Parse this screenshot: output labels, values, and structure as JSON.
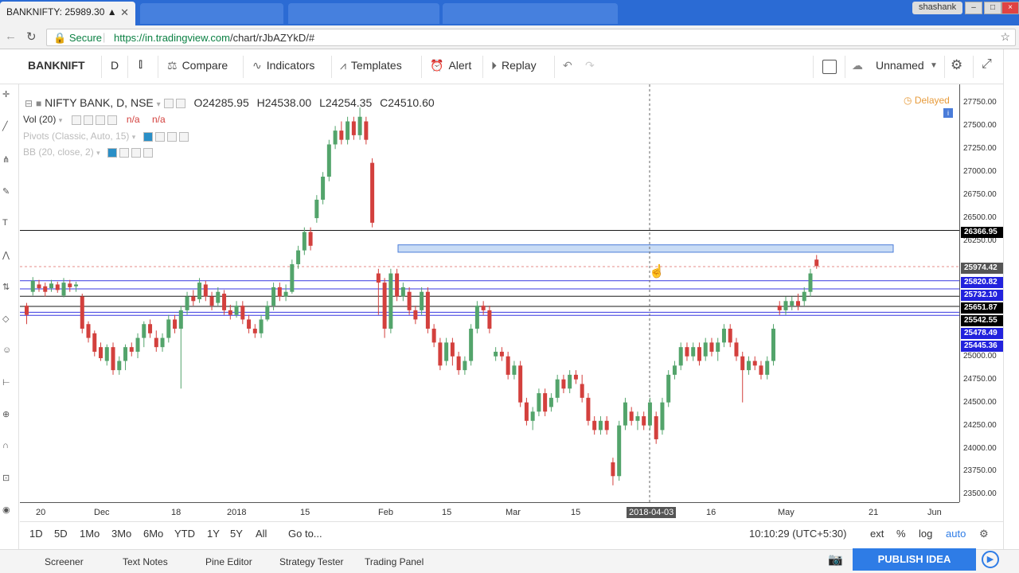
{
  "browser": {
    "tab_title": "BANKNIFTY: 25989.30 ▲",
    "tab_close": "✕",
    "profile": "shashank",
    "secure_label": "Secure",
    "url_host": "https://in.tradingview.com",
    "url_path": "/chart/rJbAZYkD/#"
  },
  "toolbar": {
    "symbol": "BANKNIFT",
    "interval": "D",
    "compare": "Compare",
    "indicators": "Indicators",
    "templates": "Templates",
    "alert": "Alert",
    "replay": "Replay",
    "layout_name": "Unnamed"
  },
  "legend": {
    "title": "NIFTY BANK, D, NSE",
    "open": "O24285.95",
    "high": "H24538.00",
    "low": "L24254.35",
    "close": "C24510.60",
    "vol": "Vol (20)",
    "vol_a": "n/a",
    "vol_b": "n/a",
    "pivots": "Pivots (Classic, Auto, 15)",
    "bb": "BB (20, close, 2)",
    "delayed": "Delayed"
  },
  "price_axis": {
    "ticks": [
      "27750.00",
      "27500.00",
      "27250.00",
      "27000.00",
      "26750.00",
      "26500.00",
      "26250.00",
      "25000.00",
      "24750.00",
      "24500.00",
      "24250.00",
      "24000.00",
      "23750.00",
      "23500.00"
    ],
    "tags": [
      {
        "label": "26366.95",
        "color": "#000000"
      },
      {
        "label": "25974.42",
        "color": "#555555"
      },
      {
        "label": "25820.82",
        "color": "#2222dd"
      },
      {
        "label": "25732.10",
        "color": "#2222dd"
      },
      {
        "label": "25651.87",
        "color": "#000000"
      },
      {
        "label": "25542.55",
        "color": "#000000"
      },
      {
        "label": "25478.49",
        "color": "#2222dd"
      },
      {
        "label": "25445.36",
        "color": "#2222dd"
      }
    ]
  },
  "time_axis": {
    "labels": [
      "20",
      "Dec",
      "18",
      "2018",
      "15",
      "Feb",
      "15",
      "Mar",
      "15",
      "2018-04-03",
      "16",
      "May",
      "21",
      "Jun"
    ]
  },
  "range_bar": {
    "ranges": [
      "1D",
      "5D",
      "1Mo",
      "3Mo",
      "6Mo",
      "YTD",
      "1Y",
      "5Y",
      "All"
    ],
    "goto": "Go to...",
    "clock": "10:10:29 (UTC+5:30)",
    "ext": "ext",
    "pct": "%",
    "log": "log",
    "auto": "auto"
  },
  "bottom_tabs": [
    "Screener",
    "Text Notes",
    "Pine Editor",
    "Strategy Tester",
    "Trading Panel"
  ],
  "publish": "PUBLISH IDEA",
  "colors": {
    "up": "#53a46b",
    "down": "#d3403d",
    "accent": "#2e7ce6"
  },
  "chart_data": {
    "type": "candlestick",
    "ylim": [
      23400,
      27900
    ],
    "candles": [
      [
        25550,
        25450,
        25580,
        25350
      ],
      [
        25700,
        25820,
        25860,
        25660
      ],
      [
        25780,
        25740,
        25830,
        25700
      ],
      [
        25760,
        25700,
        25800,
        25650
      ],
      [
        25740,
        25790,
        25830,
        25700
      ],
      [
        25780,
        25720,
        25810,
        25690
      ],
      [
        25660,
        25800,
        25850,
        25640
      ],
      [
        25790,
        25750,
        25830,
        25700
      ],
      [
        25760,
        25780,
        25810,
        25700
      ],
      [
        25650,
        25300,
        25680,
        25250
      ],
      [
        25350,
        25200,
        25380,
        25150
      ],
      [
        25250,
        25050,
        25280,
        25000
      ],
      [
        25100,
        24980,
        25150,
        24950
      ],
      [
        24950,
        25100,
        25130,
        24900
      ],
      [
        25100,
        24850,
        25150,
        24800
      ],
      [
        24850,
        24950,
        25000,
        24800
      ],
      [
        24950,
        25100,
        25130,
        24850
      ],
      [
        25100,
        25050,
        25150,
        25000
      ],
      [
        25050,
        25200,
        25250,
        24980
      ],
      [
        25200,
        25350,
        25380,
        25100
      ],
      [
        25350,
        25250,
        25400,
        25200
      ],
      [
        25200,
        25100,
        25280,
        25050
      ],
      [
        25100,
        25200,
        25250,
        25050
      ],
      [
        25200,
        25400,
        25450,
        25150
      ],
      [
        25400,
        25300,
        25450,
        25250
      ],
      [
        25300,
        25500,
        25550,
        24650
      ],
      [
        25500,
        25650,
        25700,
        25450
      ],
      [
        25650,
        25600,
        25720,
        25550
      ],
      [
        25620,
        25800,
        25850,
        25580
      ],
      [
        25780,
        25650,
        25820,
        25600
      ],
      [
        25650,
        25550,
        25700,
        25500
      ],
      [
        25580,
        25700,
        25750,
        25550
      ],
      [
        25680,
        25500,
        25720,
        25450
      ],
      [
        25500,
        25450,
        25560,
        25400
      ],
      [
        25450,
        25550,
        25600,
        25420
      ],
      [
        25550,
        25400,
        25600,
        25350
      ],
      [
        25400,
        25300,
        25450,
        25250
      ],
      [
        25300,
        25250,
        25350,
        25200
      ],
      [
        25250,
        25400,
        25450,
        25200
      ],
      [
        25400,
        25550,
        25600,
        25380
      ],
      [
        25550,
        25750,
        25800,
        25500
      ],
      [
        25750,
        25650,
        25800,
        25600
      ],
      [
        25650,
        25700,
        25780,
        25600
      ],
      [
        25700,
        26000,
        26050,
        25680
      ],
      [
        26000,
        26150,
        26200,
        25950
      ],
      [
        26150,
        26350,
        26400,
        26100
      ],
      [
        26350,
        26200,
        26400,
        26150
      ],
      [
        26500,
        26700,
        26750,
        26450
      ],
      [
        26700,
        26950,
        27000,
        26650
      ],
      [
        26950,
        27300,
        27350,
        26900
      ],
      [
        27300,
        27450,
        27500,
        27250
      ],
      [
        27450,
        27350,
        27550,
        27300
      ],
      [
        27350,
        27550,
        27600,
        27300
      ],
      [
        27550,
        27400,
        27600,
        27350
      ],
      [
        27400,
        27600,
        27700,
        27350
      ],
      [
        27550,
        27350,
        27600,
        27300
      ],
      [
        27100,
        26450,
        27150,
        26400
      ],
      [
        25900,
        25800,
        25950,
        25450
      ],
      [
        25800,
        25300,
        25850,
        25200
      ],
      [
        25300,
        25900,
        25950,
        25250
      ],
      [
        25900,
        25650,
        25950,
        25600
      ],
      [
        25650,
        25750,
        25800,
        25600
      ],
      [
        25700,
        25500,
        25750,
        25450
      ],
      [
        25500,
        25400,
        25550,
        25350
      ],
      [
        25500,
        25700,
        25750,
        25450
      ],
      [
        25700,
        25300,
        25750,
        25250
      ],
      [
        25300,
        25150,
        25350,
        25100
      ],
      [
        25150,
        24900,
        25200,
        24850
      ],
      [
        24950,
        25150,
        25200,
        24900
      ],
      [
        25150,
        25000,
        25200,
        24900
      ],
      [
        25000,
        24850,
        25050,
        24800
      ],
      [
        24850,
        24950,
        25000,
        24800
      ],
      [
        24950,
        25300,
        25350,
        24900
      ],
      [
        25300,
        25550,
        25600,
        25250
      ],
      [
        25550,
        25500,
        25600,
        25450
      ],
      [
        25500,
        25300,
        25550,
        25250
      ],
      [
        25000,
        25050,
        25100,
        24950
      ],
      [
        25050,
        25000,
        25100,
        24950
      ],
      [
        25000,
        24800,
        25050,
        24750
      ],
      [
        24800,
        24900,
        24950,
        24750
      ],
      [
        24900,
        24500,
        24950,
        24450
      ],
      [
        24500,
        24300,
        24550,
        24250
      ],
      [
        24300,
        24400,
        24450,
        24200
      ],
      [
        24400,
        24600,
        24650,
        24350
      ],
      [
        24600,
        24400,
        24650,
        24350
      ],
      [
        24450,
        24550,
        24600,
        24400
      ],
      [
        24550,
        24750,
        24800,
        24500
      ],
      [
        24750,
        24650,
        24800,
        24600
      ],
      [
        24650,
        24800,
        24850,
        24600
      ],
      [
        24800,
        24750,
        24850,
        24700
      ],
      [
        24700,
        24550,
        24800,
        24500
      ],
      [
        24550,
        24300,
        24600,
        24250
      ],
      [
        24300,
        24200,
        24350,
        24150
      ],
      [
        24200,
        24300,
        24350,
        24150
      ],
      [
        24300,
        24200,
        24350,
        24150
      ],
      [
        23850,
        23700,
        23900,
        23600
      ],
      [
        23700,
        24250,
        24300,
        23650
      ],
      [
        24250,
        24500,
        24550,
        24200
      ],
      [
        24400,
        24300,
        24450,
        24250
      ],
      [
        24300,
        24350,
        24400,
        24200
      ],
      [
        24350,
        24250,
        24400,
        24200
      ],
      [
        24250,
        24500,
        24550,
        24200
      ],
      [
        24350,
        24100,
        24400,
        24050
      ],
      [
        24200,
        24500,
        24550,
        24150
      ],
      [
        24500,
        24800,
        24850,
        24450
      ],
      [
        24800,
        24900,
        24950,
        24750
      ],
      [
        24900,
        25100,
        25150,
        24850
      ],
      [
        25100,
        25000,
        25150,
        24950
      ],
      [
        25000,
        25100,
        25150,
        24950
      ],
      [
        25100,
        24950,
        25150,
        24900
      ],
      [
        25000,
        25150,
        25200,
        24950
      ],
      [
        25150,
        25050,
        25200,
        25000
      ],
      [
        25050,
        25150,
        25200,
        24950
      ],
      [
        25150,
        25300,
        25350,
        25100
      ],
      [
        25300,
        25150,
        25350,
        25100
      ],
      [
        25150,
        25000,
        25200,
        24950
      ],
      [
        25000,
        24850,
        25050,
        24500
      ],
      [
        24850,
        24950,
        25000,
        24800
      ],
      [
        24950,
        24900,
        25000,
        24850
      ],
      [
        24900,
        24800,
        24950,
        24750
      ],
      [
        24800,
        24950,
        25000,
        24750
      ],
      [
        24950,
        25300,
        25350,
        24900
      ],
      [
        25550,
        25500,
        25600,
        25450
      ],
      [
        25500,
        25600,
        25650,
        25450
      ],
      [
        25550,
        25600,
        25650,
        25500
      ],
      [
        25600,
        25550,
        25680,
        25500
      ],
      [
        25600,
        25700,
        25750,
        25550
      ],
      [
        25700,
        25900,
        25950,
        25650
      ],
      [
        26050,
        25980,
        26100,
        25950
      ]
    ]
  }
}
